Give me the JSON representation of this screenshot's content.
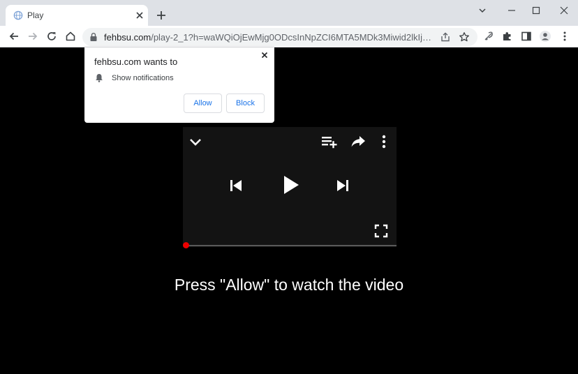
{
  "browser": {
    "tab": {
      "title": "Play",
      "favicon": "globe-icon"
    },
    "omnibox": {
      "host": "fehbsu.com",
      "path": "/play-2_1?h=waWQiOjEwMjg0ODcsInNpZCI6MTA5MDk3Miwid2lkIjoyOTY1N..."
    }
  },
  "notification_prompt": {
    "title": "fehbsu.com wants to",
    "permission": "Show notifications",
    "allow_label": "Allow",
    "block_label": "Block"
  },
  "video_player": {
    "progress_percent": 0,
    "icons": [
      "chevron-down-icon",
      "add-to-queue-icon",
      "share-icon",
      "more-vert-icon",
      "skip-previous-icon",
      "play-icon",
      "skip-next-icon",
      "fullscreen-icon"
    ]
  },
  "page": {
    "message": "Press \"Allow\" to watch the video"
  },
  "colors": {
    "progress": "#ee0000",
    "button_text": "#1a73e8",
    "page_background": "#000000"
  }
}
